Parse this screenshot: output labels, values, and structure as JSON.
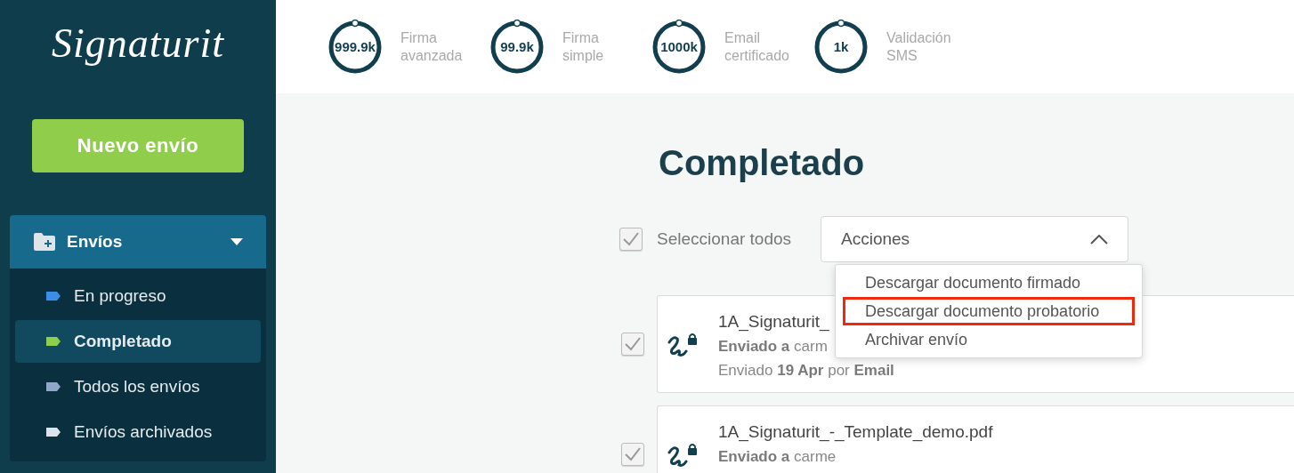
{
  "sidebar": {
    "logo": "Signaturit",
    "new_button": "Nuevo envío",
    "section": {
      "label": "Envíos",
      "expanded": true,
      "items": [
        {
          "label": "En progreso",
          "color": "#3a8ee6",
          "selected": false
        },
        {
          "label": "Completado",
          "color": "#8ccf4d",
          "selected": true
        },
        {
          "label": "Todos los envíos",
          "color": "#8fa8c8",
          "selected": false
        },
        {
          "label": "Envíos archivados",
          "color": "#dde3ea",
          "selected": false
        }
      ]
    }
  },
  "counters": [
    {
      "value": "999.9k",
      "label": "Firma avanzada"
    },
    {
      "value": "99.9k",
      "label": "Firma simple"
    },
    {
      "value": "1000k",
      "label": "Email certificado"
    },
    {
      "value": "1k",
      "label": "Validación SMS"
    }
  ],
  "title": "Completado",
  "select_all": {
    "label": "Seleccionar todos",
    "checked": true
  },
  "actions": {
    "label": "Acciones",
    "expanded": true,
    "options": [
      {
        "label": "Descargar documento firmado",
        "highlighted": false
      },
      {
        "label": "Descargar documento probatorio",
        "highlighted": true
      },
      {
        "label": "Archivar envío",
        "highlighted": false
      }
    ]
  },
  "documents": [
    {
      "name": "1A_Signaturit_",
      "sent_to_label": "Enviado a",
      "sent_to": "carm",
      "sent_line": "Enviado **19 Apr** por **Email**",
      "checked": true
    },
    {
      "name": "1A_Signaturit_-_Template_demo.pdf",
      "sent_to_label": "Enviado a",
      "sent_to": "carme",
      "checked": true
    }
  ]
}
